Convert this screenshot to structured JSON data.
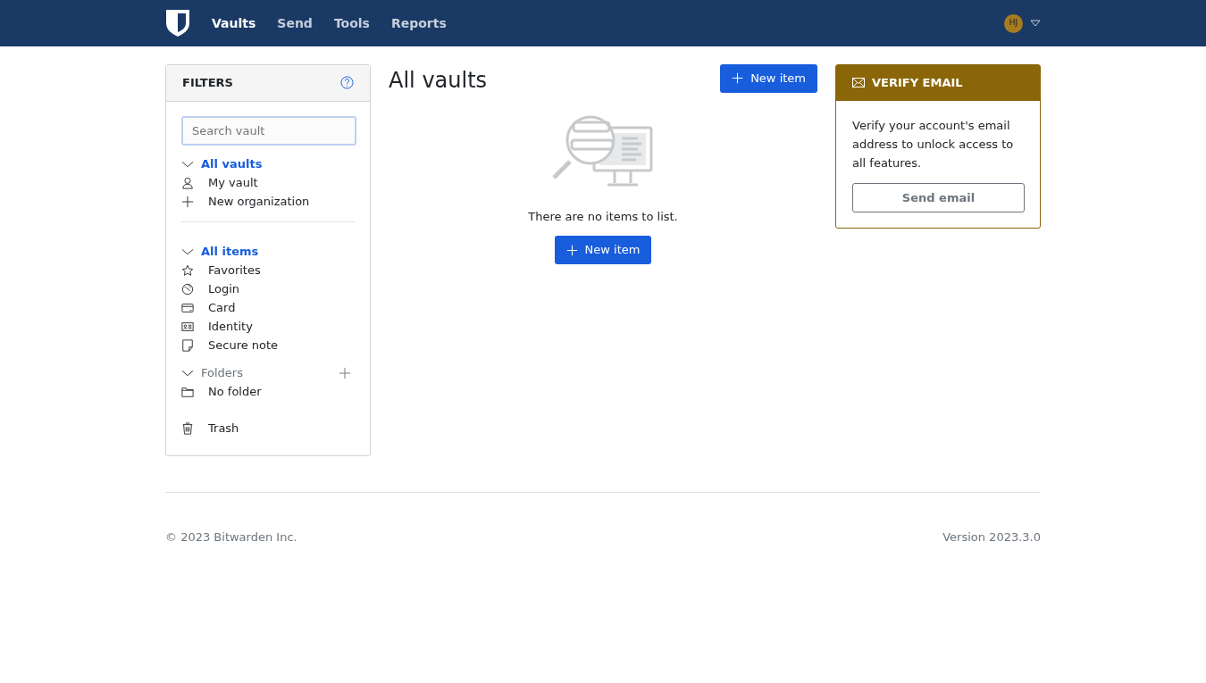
{
  "navbar": {
    "links": [
      {
        "label": "Vaults",
        "selected": true
      },
      {
        "label": "Send",
        "selected": false
      },
      {
        "label": "Tools",
        "selected": false
      },
      {
        "label": "Reports",
        "selected": false
      }
    ],
    "avatar": {
      "initials": "HJ",
      "color": "#a67c1e"
    }
  },
  "filters": {
    "title": "FILTERS",
    "search": {
      "placeholder": "Search vault"
    },
    "groups": [
      {
        "label": "All vaults",
        "selected": true,
        "expanded": true,
        "children": [
          {
            "label": "My vault",
            "kind": "person",
            "selected": false
          },
          {
            "label": "New organization",
            "kind": "plus",
            "selected": false
          }
        ]
      },
      {
        "label": "All items",
        "selected": true,
        "expanded": true,
        "children": [
          {
            "label": "Favorites",
            "kind": "star",
            "selected": false
          },
          {
            "label": "Login",
            "kind": "globe",
            "selected": false
          },
          {
            "label": "Card",
            "kind": "card",
            "selected": false
          },
          {
            "label": "Identity",
            "kind": "id",
            "selected": false
          },
          {
            "label": "Secure note",
            "kind": "note",
            "selected": false
          }
        ]
      },
      {
        "label": "Folders",
        "selected": false,
        "expanded": true,
        "addable": true,
        "children": [
          {
            "label": "No folder",
            "kind": "folder",
            "selected": false
          }
        ]
      }
    ],
    "trash": {
      "label": "Trash",
      "selected": false
    }
  },
  "main": {
    "title": "All vaults",
    "new_button": "New item",
    "empty_text": "There are no items to list.",
    "empty_button": "New item"
  },
  "verify": {
    "title": "VERIFY EMAIL",
    "text": "Verify your account's email address to unlock access to all features.",
    "button": "Send email"
  },
  "footer": {
    "copyright": "© 2023 Bitwarden Inc.",
    "version": "Version 2023.3.0"
  }
}
